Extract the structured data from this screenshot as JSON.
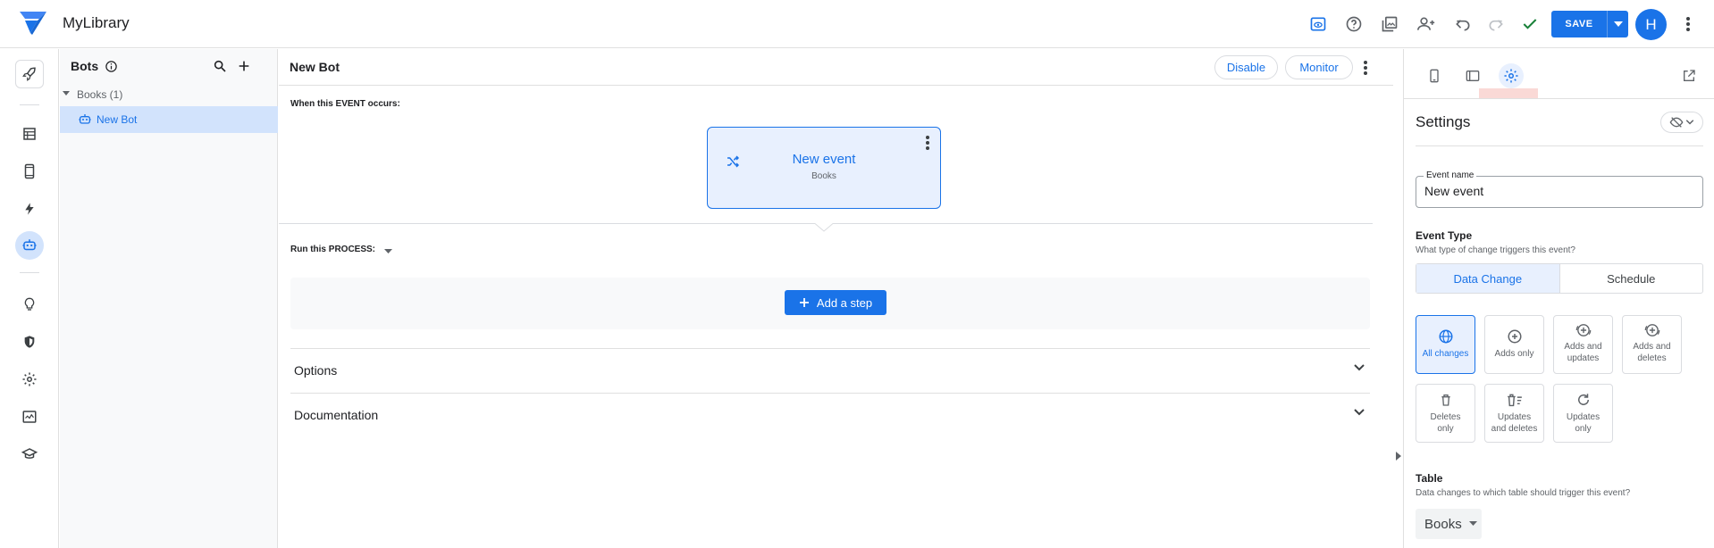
{
  "app": {
    "title": "MyLibrary"
  },
  "topbar": {
    "save_label": "SAVE",
    "avatar_initial": "H"
  },
  "bots_panel": {
    "title": "Bots",
    "tree": {
      "group_label": "Books (1)",
      "item_label": "New Bot"
    }
  },
  "main": {
    "bot_title": "New Bot",
    "disable_label": "Disable",
    "monitor_label": "Monitor",
    "event_section_label": "When this EVENT occurs:",
    "event_card": {
      "title": "New event",
      "subtitle": "Books"
    },
    "process_label": "Run this PROCESS:",
    "add_step_label": "Add a step",
    "options_label": "Options",
    "documentation_label": "Documentation"
  },
  "settings": {
    "title": "Settings",
    "event_name_label": "Event name",
    "event_name_value": "New event",
    "event_type_heading": "Event Type",
    "event_type_help": "What type of change triggers this event?",
    "event_type_options": [
      "Data Change",
      "Schedule"
    ],
    "selected_event_type": "Data Change",
    "change_types": [
      {
        "line1": "All changes",
        "line2": "",
        "active": true
      },
      {
        "line1": "Adds only",
        "line2": "",
        "active": false
      },
      {
        "line1": "Adds and",
        "line2": "updates",
        "active": false
      },
      {
        "line1": "Adds and",
        "line2": "deletes",
        "active": false
      },
      {
        "line1": "Deletes",
        "line2": "only",
        "active": false
      },
      {
        "line1": "Updates",
        "line2": "and deletes",
        "active": false
      },
      {
        "line1": "Updates",
        "line2": "only",
        "active": false
      }
    ],
    "table_heading": "Table",
    "table_help": "Data changes to which table should trigger this event?",
    "table_value": "Books"
  },
  "colors": {
    "accent": "#1a73e8",
    "accent_light": "#e8f0fe",
    "selected_row": "#d2e3fc",
    "check": "#188038"
  }
}
